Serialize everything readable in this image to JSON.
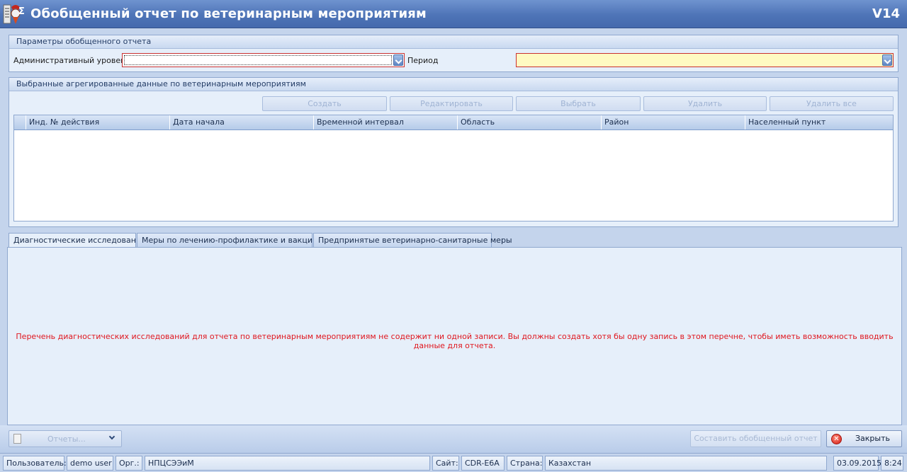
{
  "window": {
    "title": "Обобщенный отчет по ветеринарным мероприятиям",
    "version": "V14"
  },
  "params": {
    "header": "Параметры обобщенного отчета",
    "admin_level_label": "Административный уровень",
    "admin_level_value": "",
    "period_label": "Период",
    "period_value": ""
  },
  "aggregated": {
    "header": "Выбранные агрегированные данные по ветеринарным мероприятиям",
    "buttons": {
      "create": "Создать",
      "edit": "Редактировать",
      "select": "Выбрать",
      "delete": "Удалить",
      "delete_all": "Удалить все"
    },
    "columns": [
      "Инд. № действия",
      "Дата начала",
      "Временной интервал",
      "Область",
      "Район",
      "Населенный пункт"
    ],
    "rows": []
  },
  "tabs": [
    {
      "label": "Диагностические исследования",
      "active": true
    },
    {
      "label": "Меры по лечению-профилактике и вакцинации",
      "active": false
    },
    {
      "label": "Предпринятые ветеринарно-санитарные меры",
      "active": false
    }
  ],
  "tab_message": "Перечень диагностических исследований для отчета по ветеринарным мероприятиям не содержит ни одной записи. Вы должны создать хотя бы одну запись в этом перечне, чтобы иметь возможность вводить данные для отчета.",
  "footer": {
    "reports_label": "Отчеты...",
    "compose_label": "Составить обобщенный отчет",
    "close_label": "Закрыть"
  },
  "status": {
    "user_label": "Пользователь:",
    "user_value": "demo user",
    "org_label": "Орг.:",
    "org_value": "НПЦСЭЭиМ",
    "site_label": "Сайт:",
    "site_value": "CDR-E6A",
    "country_label": "Страна:",
    "country_value": "Казахстан",
    "date": "03.09.2015",
    "time": "8:24"
  },
  "colors": {
    "title_bar": "#4e74b7",
    "panel_bg": "#e6effa",
    "required_border": "#c93131",
    "message_text": "#e0171f",
    "period_field_bg": "#fffac2"
  }
}
